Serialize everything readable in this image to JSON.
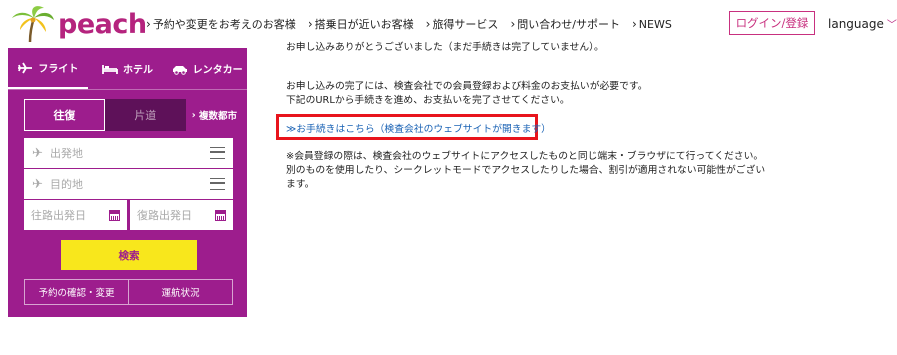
{
  "header": {
    "logo_text": "peach",
    "nav": [
      {
        "label": "予約や変更をお考えのお客様"
      },
      {
        "label": "搭乗日が近いお客様"
      },
      {
        "label": "旅得サービス"
      },
      {
        "label": "問い合わせ/サポート"
      },
      {
        "label": "NEWS"
      }
    ],
    "login_label": "ログイン/登録",
    "language_label": "language"
  },
  "panel": {
    "tabs": [
      {
        "label": "フライト",
        "icon": "plane-icon"
      },
      {
        "label": "ホテル",
        "icon": "bed-icon"
      },
      {
        "label": "レンタカー",
        "icon": "car-icon"
      }
    ],
    "roundtrip_label": "往復",
    "oneway_label": "片道",
    "multi_city_label": "複数都市",
    "origin_placeholder": "出発地",
    "destination_placeholder": "目的地",
    "depart_date_placeholder": "往路出発日",
    "return_date_placeholder": "復路出発日",
    "search_label": "検索",
    "manage_label": "予約の確認・変更",
    "status_label": "運航状況"
  },
  "content": {
    "line1": "お申し込みありがとうございました（まだ手続きは完了していません）。",
    "line2a": "お申し込みの完了には、検査会社での会員登録および料金のお支払いが必要です。",
    "line2b": "下記のURLから手続きを進め、お支払いを完了させてください。",
    "link": "≫お手続きはこちら（検査会社のウェブサイトが開きます）",
    "line3a": "※会員登録の際は、検査会社のウェブサイトにアクセスしたものと同じ端末・ブラウザにて行ってください。",
    "line3b": "別のものを使用したり、シークレットモードでアクセスしたりした場合、割引が適用されない可能性がござい",
    "line3c": "ます。"
  },
  "colors": {
    "brand": "#b5247e",
    "panel": "#9d1d8d",
    "search_button": "#f8e71c",
    "highlight": "#e8141c",
    "link": "#1b63b5"
  }
}
